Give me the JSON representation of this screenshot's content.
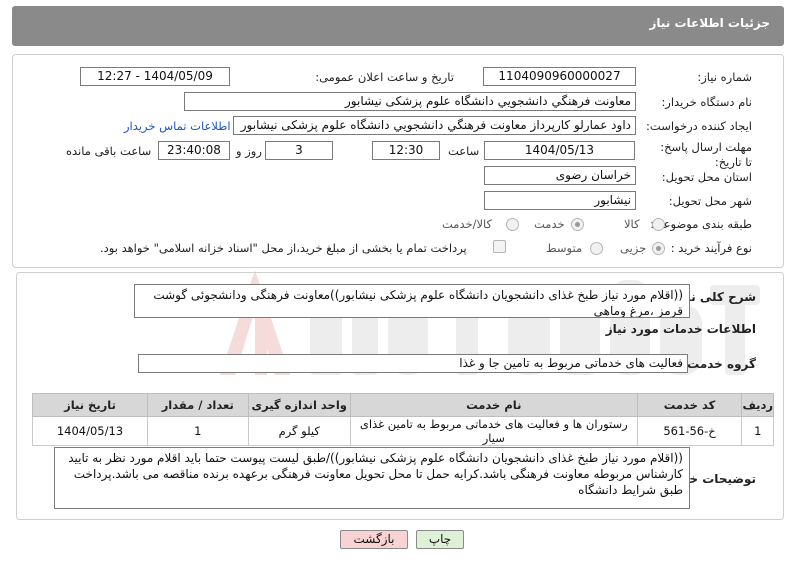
{
  "header": {
    "title": "جزئیات اطلاعات نیاز"
  },
  "form": {
    "need_number": {
      "label": "شماره نیاز:",
      "value": "1104090960000027"
    },
    "announce": {
      "label": "تاریخ و ساعت اعلان عمومی:",
      "value": "1404/05/09 - 12:27"
    },
    "buyer_org": {
      "label": "نام دستگاه خریدار:",
      "value": "معاونت فرهنگي دانشجويي دانشگاه علوم پزشکی نيشابور"
    },
    "creator": {
      "label": "ایجاد کننده درخواست:",
      "value": "داود عمارلو کارپرداز معاونت فرهنگي دانشجويي دانشگاه علوم پزشکی نيشابور"
    },
    "contact_link": "اطلاعات تماس خریدار",
    "deadline": {
      "label": "مهلت ارسال پاسخ: تا تاریخ:",
      "date": "1404/05/13",
      "time_label": "ساعت",
      "time": "12:30",
      "days": "3",
      "days_label": "روز و",
      "remaining": "23:40:08",
      "remaining_label": "ساعت باقی مانده"
    },
    "province": {
      "label": "استان محل تحویل:",
      "value": "خراسان رضوی"
    },
    "city": {
      "label": "شهر محل تحویل:",
      "value": "نیشابور"
    },
    "category": {
      "label": "طبقه بندی موضوعی:",
      "options": [
        "کالا",
        "خدمت",
        "کالا/خدمت"
      ],
      "selected": "خدمت"
    },
    "process": {
      "label": "نوع فرآیند خرید :",
      "options": [
        "جزیی",
        "متوسط"
      ],
      "selected": "جزیی",
      "payment_note": "پرداخت تمام یا بخشی از مبلغ خرید،از محل \"اسناد خزانه اسلامی\" خواهد بود."
    }
  },
  "summary": {
    "label": "شرح کلی نیاز:",
    "text": "((اقلام مورد نیاز طبخ غذای دانشجویان دانشگاه علوم پزشکی نیشابور))معاونت فرهنگی ودانشجوئی گوشت قرمز ،مرغ وماهی"
  },
  "services": {
    "title": "اطلاعات خدمات مورد نیاز",
    "group_label": "گروه خدمت:",
    "group_value": "فعالیت های خدماتی مربوط به تامین جا و غذا",
    "columns": [
      "ردیف",
      "کد خدمت",
      "نام خدمت",
      "واحد اندازه گیری",
      "تعداد / مقدار",
      "تاریخ نیاز"
    ],
    "rows": [
      [
        "1",
        "خ-56-561",
        "رستوران ها و فعالیت های خدماتی مربوط به تامین غذای سیار",
        "کیلو گرم",
        "1",
        "1404/05/13"
      ]
    ]
  },
  "buyer_notes": {
    "label": "توضیحات خریدار:",
    "text": "((اقلام مورد نیاز طبخ غذای دانشجویان دانشگاه علوم پزشکی نیشابور))/طبق لیست پیوست حتما باید اقلام مورد نظر به تایید کارشناس مربوطه معاونت فرهنگی باشد.کرایه حمل تا محل تحویل معاونت فرهنگی برعهده برنده مناقصه می باشد.پرداخت طبق شرایط دانشگاه"
  },
  "buttons": {
    "print": "چاپ",
    "back": "بازگشت"
  },
  "colors": {
    "header_bg": "#8a8a8a",
    "link": "#1a56c4",
    "back_button": "#f9d3d3",
    "print_button": "#dff0d8",
    "watermark": "#f2c9c9"
  }
}
